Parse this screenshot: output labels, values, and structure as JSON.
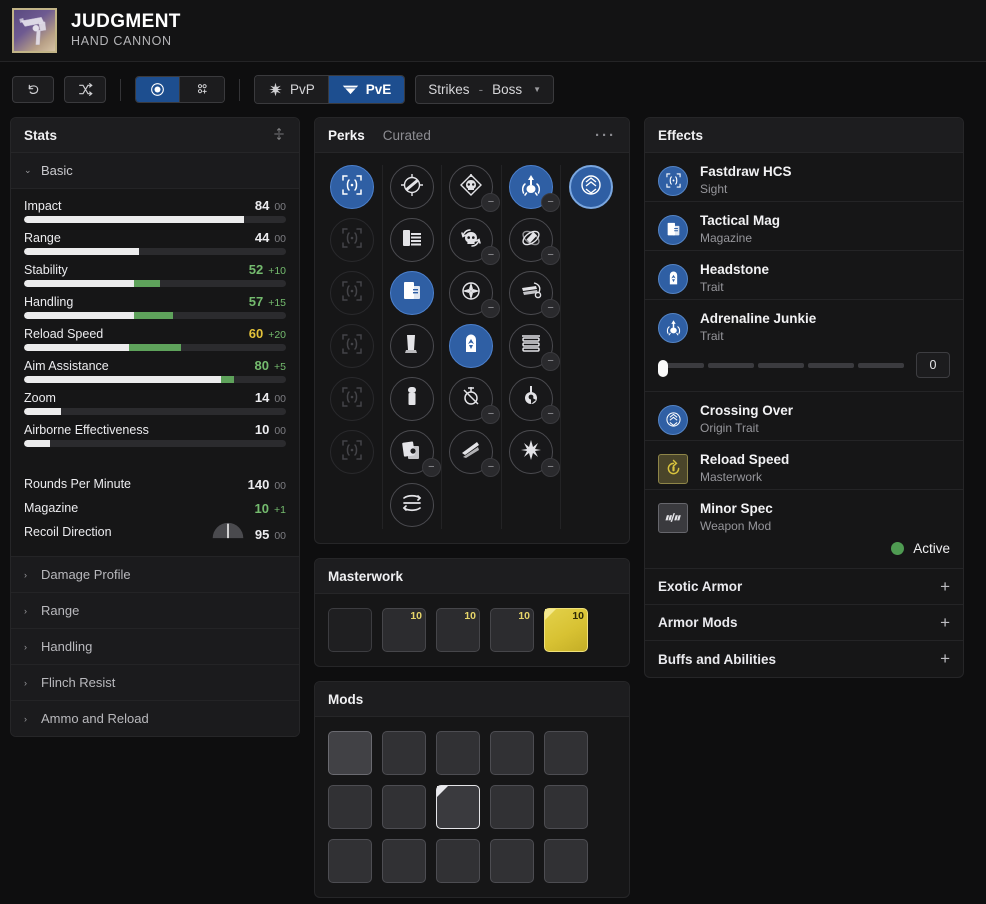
{
  "header": {
    "title": "JUDGMENT",
    "subtitle": "HAND CANNON",
    "icon_name": "hand-cannon-weapon-icon"
  },
  "toolbar": {
    "undo_label": "↺",
    "shuffle_label": "⤨",
    "view_single_label": "◉",
    "view_compare_label": "⁙",
    "pvp_label": "PvP",
    "pve_label": "PvE",
    "pve_active": true,
    "activity_primary": "Strikes",
    "activity_sep": "-",
    "activity_secondary": "Boss"
  },
  "stats": {
    "panel_title": "Stats",
    "group_label": "Basic",
    "bars": [
      {
        "name": "Impact",
        "value": "84",
        "delta": "00",
        "base_pct": 84,
        "bonus_pct": 0,
        "value_color": "white",
        "delta_color": "grey"
      },
      {
        "name": "Range",
        "value": "44",
        "delta": "00",
        "base_pct": 44,
        "bonus_pct": 0,
        "value_color": "white",
        "delta_color": "grey"
      },
      {
        "name": "Stability",
        "value": "52",
        "delta": "+10",
        "base_pct": 42,
        "bonus_pct": 10,
        "value_color": "green",
        "delta_color": "green"
      },
      {
        "name": "Handling",
        "value": "57",
        "delta": "+15",
        "base_pct": 42,
        "bonus_pct": 15,
        "value_color": "green",
        "delta_color": "green"
      },
      {
        "name": "Reload Speed",
        "value": "60",
        "delta": "+20",
        "base_pct": 40,
        "bonus_pct": 20,
        "value_color": "gold",
        "delta_color": "green"
      },
      {
        "name": "Aim Assistance",
        "value": "80",
        "delta": "+5",
        "base_pct": 75,
        "bonus_pct": 5,
        "value_color": "green",
        "delta_color": "green"
      },
      {
        "name": "Zoom",
        "value": "14",
        "delta": "00",
        "base_pct": 14,
        "bonus_pct": 0,
        "value_color": "white",
        "delta_color": "grey"
      },
      {
        "name": "Airborne Effectiveness",
        "value": "10",
        "delta": "00",
        "base_pct": 10,
        "bonus_pct": 0,
        "value_color": "white",
        "delta_color": "grey"
      }
    ],
    "simple": [
      {
        "name": "Rounds Per Minute",
        "value": "140",
        "delta": "00",
        "value_color": "white",
        "delta_color": "grey",
        "gauge": false
      },
      {
        "name": "Magazine",
        "value": "10",
        "delta": "+1",
        "value_color": "green",
        "delta_color": "green",
        "gauge": false
      },
      {
        "name": "Recoil Direction",
        "value": "95",
        "delta": "00",
        "value_color": "white",
        "delta_color": "grey",
        "gauge": true
      }
    ],
    "sections": [
      "Damage Profile",
      "Range",
      "Handling",
      "Flinch Resist",
      "Ammo and Reload"
    ]
  },
  "perks": {
    "tab_perks": "Perks",
    "tab_curated": "Curated",
    "menu_label": "···",
    "columns": [
      {
        "name": "sight-column",
        "slots": [
          {
            "icon": "sight-icon",
            "state": "selected",
            "minus": false
          },
          {
            "icon": "sight-icon",
            "state": "dim",
            "minus": false
          },
          {
            "icon": "sight-icon",
            "state": "dim",
            "minus": false
          },
          {
            "icon": "sight-icon",
            "state": "dim",
            "minus": false
          },
          {
            "icon": "sight-icon",
            "state": "dim",
            "minus": false
          },
          {
            "icon": "sight-icon",
            "state": "dim",
            "minus": false
          }
        ]
      },
      {
        "name": "magazine-column",
        "slots": [
          {
            "icon": "barrel-icon",
            "state": "normal",
            "minus": false
          },
          {
            "icon": "mag-stack-icon",
            "state": "normal",
            "minus": false
          },
          {
            "icon": "tactical-mag-icon",
            "state": "selected",
            "minus": false
          },
          {
            "icon": "flared-mag-icon",
            "state": "normal",
            "minus": false
          },
          {
            "icon": "alloy-mag-icon",
            "state": "normal",
            "minus": false
          },
          {
            "icon": "appended-mag-icon",
            "state": "normal",
            "minus": true
          },
          {
            "icon": "drum-mag-icon",
            "state": "normal",
            "minus": false
          }
        ]
      },
      {
        "name": "trait1-column",
        "slots": [
          {
            "icon": "skull-diamond-icon",
            "state": "normal",
            "minus": true
          },
          {
            "icon": "skull-cycle-icon",
            "state": "normal",
            "minus": true
          },
          {
            "icon": "compass-icon",
            "state": "normal",
            "minus": true
          },
          {
            "icon": "headstone-icon",
            "state": "selected",
            "minus": false
          },
          {
            "icon": "crossed-circle-icon",
            "state": "normal",
            "minus": true
          },
          {
            "icon": "slash-icon",
            "state": "normal",
            "minus": true
          }
        ]
      },
      {
        "name": "trait2-column",
        "slots": [
          {
            "icon": "adrenaline-icon",
            "state": "selected",
            "minus": true
          },
          {
            "icon": "grenade-spin-icon",
            "state": "normal",
            "minus": true
          },
          {
            "icon": "swirl-icon",
            "state": "normal",
            "minus": true
          },
          {
            "icon": "stacked-icon",
            "state": "normal",
            "minus": true
          },
          {
            "icon": "keyhole-icon",
            "state": "normal",
            "minus": true
          },
          {
            "icon": "wing-burst-icon",
            "state": "normal",
            "minus": true
          }
        ]
      },
      {
        "name": "origin-column",
        "slots": [
          {
            "icon": "crossing-over-icon",
            "state": "ring",
            "minus": false
          }
        ]
      }
    ]
  },
  "masterwork": {
    "panel_title": "Masterwork",
    "tiles": [
      {
        "name": "masterwork-none",
        "level": "",
        "state": "empty",
        "icon": "none-icon"
      },
      {
        "name": "masterwork-range",
        "level": "10",
        "state": "normal",
        "icon": "range-mw-icon"
      },
      {
        "name": "masterwork-stability",
        "level": "10",
        "state": "normal",
        "icon": "stability-mw-icon"
      },
      {
        "name": "masterwork-handling",
        "level": "10",
        "state": "normal",
        "icon": "handling-mw-icon"
      },
      {
        "name": "masterwork-reload",
        "level": "10",
        "state": "gold",
        "icon": "reload-mw-icon"
      }
    ]
  },
  "mods": {
    "panel_title": "Mods",
    "tiles": [
      {
        "name": "mod-empty",
        "icon": "empty-socket-icon",
        "state": "first"
      },
      {
        "name": "mod-backup-mag",
        "icon": "backup-mag-icon",
        "state": "normal"
      },
      {
        "name": "mod-counterbalance",
        "icon": "counterbalance-icon",
        "state": "normal"
      },
      {
        "name": "mod-freehand",
        "icon": "dots-cluster-icon",
        "state": "normal"
      },
      {
        "name": "mod-icarus",
        "icon": "icarus-grip-icon",
        "state": "normal"
      },
      {
        "name": "mod-targeting",
        "icon": "targeting-icon",
        "state": "normal"
      },
      {
        "name": "mod-sprint-grip",
        "icon": "sprint-grip-icon",
        "state": "normal"
      },
      {
        "name": "mod-minor-spec",
        "icon": "minor-spec-icon",
        "state": "active"
      },
      {
        "name": "mod-radar-tuner",
        "icon": "radar-tuner-icon",
        "state": "normal"
      },
      {
        "name": "mod-quick-access",
        "icon": "quick-access-icon",
        "state": "normal"
      },
      {
        "name": "mod-snapshot",
        "icon": "snapshot-icon",
        "state": "normal"
      },
      {
        "name": "mod-boss-spec",
        "icon": "boss-spec-icon",
        "state": "normal"
      },
      {
        "name": "mod-adept-mod",
        "icon": "adept-mod-icon",
        "state": "normal"
      },
      {
        "name": "mod-major-spec",
        "icon": "major-spec-icon",
        "state": "normal"
      },
      {
        "name": "mod-taken-spec",
        "icon": "taken-spec-icon",
        "state": "normal"
      }
    ]
  },
  "effects": {
    "panel_title": "Effects",
    "items": [
      {
        "name": "Fastdraw HCS",
        "type": "Sight",
        "icon": "sight-icon",
        "icon_style": "circle"
      },
      {
        "name": "Tactical Mag",
        "type": "Magazine",
        "icon": "tactical-mag-icon",
        "icon_style": "circle"
      },
      {
        "name": "Headstone",
        "type": "Trait",
        "icon": "headstone-icon",
        "icon_style": "circle"
      },
      {
        "name": "Adrenaline Junkie",
        "type": "Trait",
        "icon": "adrenaline-icon",
        "icon_style": "circle",
        "slider": {
          "value": "0",
          "segments": 5,
          "thumb_pct": 0
        }
      },
      {
        "name": "Crossing Over",
        "type": "Origin Trait",
        "icon": "crossing-over-icon",
        "icon_style": "circle"
      },
      {
        "name": "Reload Speed",
        "type": "Masterwork",
        "icon": "reload-mw-icon",
        "icon_style": "square-gold"
      },
      {
        "name": "Minor Spec",
        "type": "Weapon Mod",
        "icon": "minor-spec-icon",
        "icon_style": "square",
        "status": "Active"
      }
    ],
    "collapsed": [
      {
        "label": "Exotic Armor",
        "toggle": "+"
      },
      {
        "label": "Armor Mods",
        "toggle": "+"
      },
      {
        "label": "Buffs and Abilities",
        "toggle": "+"
      }
    ]
  },
  "colors": {
    "accent_blue": "#2f5fa4",
    "bonus_green": "#5ea25b",
    "masterwork_gold": "#d8c233",
    "active_green": "#4f9b52"
  }
}
